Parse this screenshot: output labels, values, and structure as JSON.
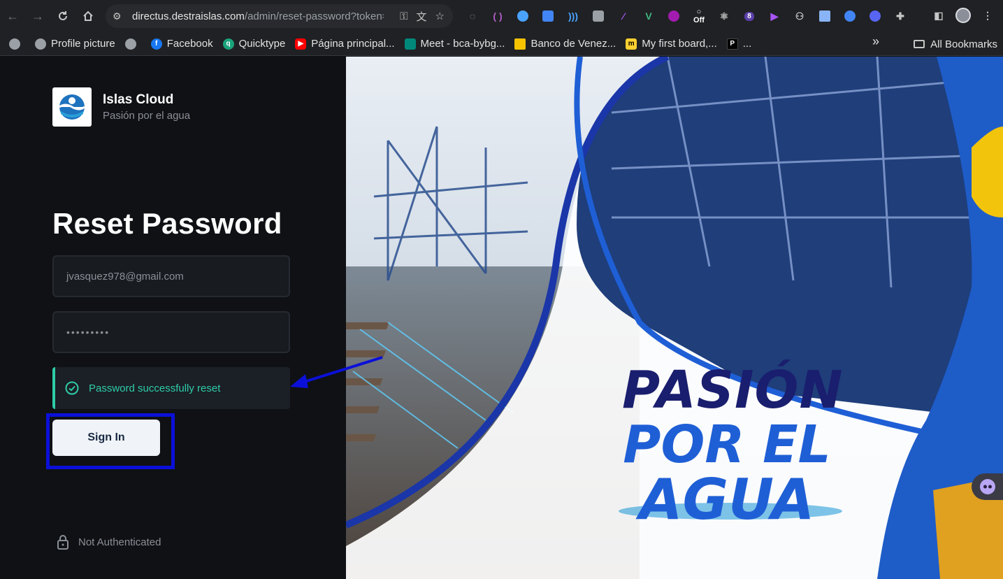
{
  "browser": {
    "url_host": "directus.destraislas.com",
    "url_path": "/admin/reset-password?token=...",
    "extension_badges": {
      "off_label": "Off",
      "count_badge": "8"
    },
    "bookmarks": [
      {
        "label": "Profile picture",
        "icon": "globe-icon",
        "color": "#9aa0a6"
      },
      {
        "label": "",
        "icon": "globe-icon",
        "color": "#9aa0a6"
      },
      {
        "label": "Facebook",
        "icon": "facebook-icon",
        "color": "#1877f2"
      },
      {
        "label": "Quicktype",
        "icon": "quicktype-icon",
        "color": "#1aa37a"
      },
      {
        "label": "Página principal...",
        "icon": "youtube-icon",
        "color": "#ff0000"
      },
      {
        "label": "Meet - bca-bybg...",
        "icon": "meet-icon",
        "color": "#00897b"
      },
      {
        "label": "Banco de Venez...",
        "icon": "bank-icon",
        "color": "#f7c300"
      },
      {
        "label": "My first board,...",
        "icon": "miro-icon",
        "color": "#ffd02f"
      },
      {
        "label": "...",
        "icon": "p-icon",
        "color": "#000000"
      }
    ],
    "more_bookmarks": "»",
    "all_bookmarks": "All Bookmarks"
  },
  "brand": {
    "name": "Islas Cloud",
    "tagline": "Pasión por el agua"
  },
  "form": {
    "title": "Reset Password",
    "email_value": "jvasquez978@gmail.com",
    "password_value": "•••••••••",
    "notice": "Password successfully reset",
    "signin_label": "Sign In"
  },
  "footer": {
    "auth_status": "Not Authenticated"
  },
  "banner": {
    "line1": "PASIÓN",
    "line2": "POR EL",
    "line3": "AGUA"
  },
  "colors": {
    "accent_success": "#2ecda7",
    "annotation_blue": "#0b10d8",
    "page_bg": "#0f1115"
  }
}
